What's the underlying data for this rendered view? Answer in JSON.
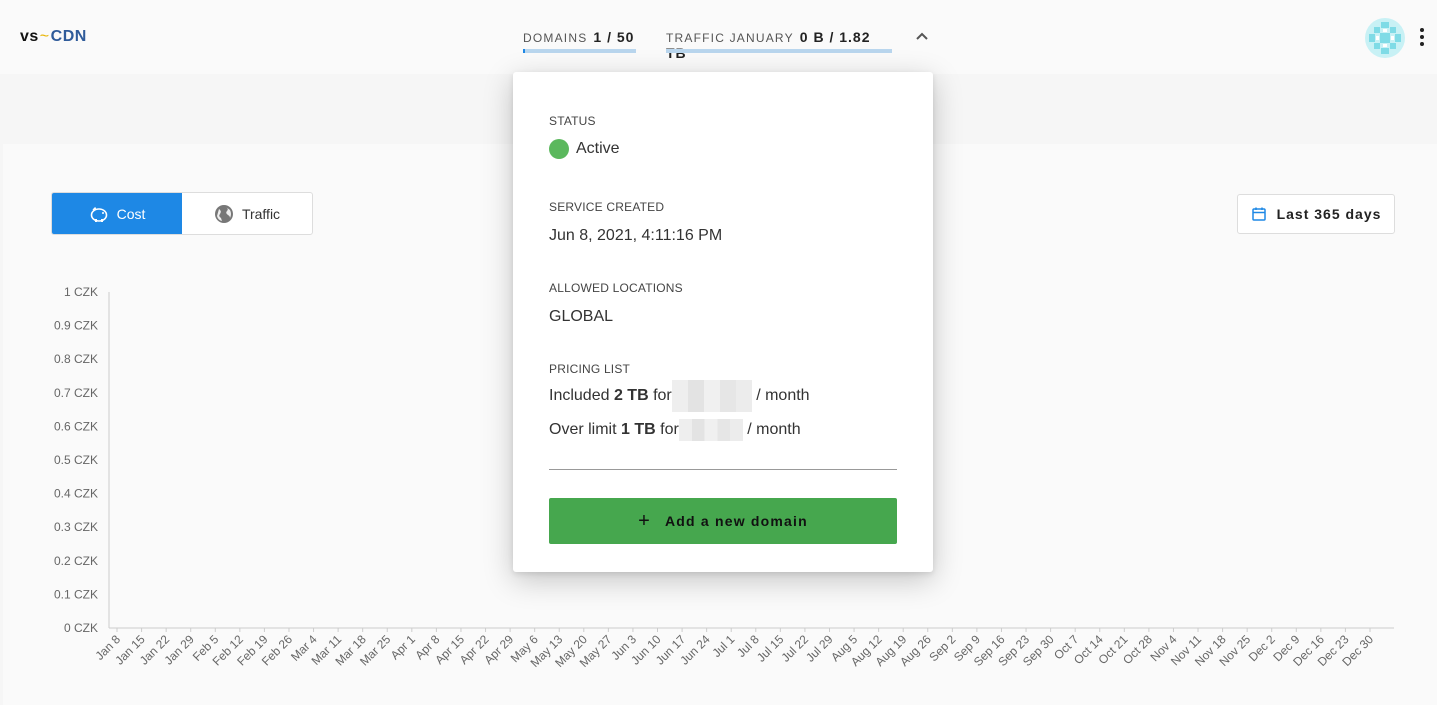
{
  "brand": {
    "vs": "vs",
    "tilde": "~",
    "cdn": "CDN",
    "colors": {
      "vs": "#111111",
      "tilde": "#e8b400",
      "cdn": "#2f5b9a"
    }
  },
  "header": {
    "domains": {
      "label": "DOMAINS",
      "value": "1 / 50",
      "fraction": 0.02
    },
    "traffic": {
      "label": "TRAFFIC JANUARY",
      "value": "0 B / 1.82 TB",
      "fraction": 0.0
    },
    "collapse_icon": "chevron-up-icon",
    "avatar_icon": "avatar-identicon",
    "menu_icon": "kebab-menu-icon"
  },
  "toggle": {
    "cost_label": "Cost",
    "traffic_label": "Traffic",
    "active": "cost",
    "cost_icon": "piggy-bank-icon",
    "traffic_icon": "globe-icon"
  },
  "date_range": {
    "label": "Last 365 days",
    "icon": "calendar-icon"
  },
  "popover": {
    "status_label": "STATUS",
    "status_value": "Active",
    "status_color": "#5bb85d",
    "created_label": "SERVICE CREATED",
    "created_value": "Jun 8, 2021, 4:11:16 PM",
    "locations_label": "ALLOWED LOCATIONS",
    "locations_value": "GLOBAL",
    "pricing_label": "PRICING LIST",
    "included_prefix": "Included",
    "included_amount": "2 TB",
    "included_for": "for",
    "included_suffix": "/ month",
    "over_prefix": "Over limit",
    "over_amount": "1 TB",
    "over_for": "for",
    "over_suffix": "/ month",
    "add_button_label": "Add a new domain",
    "add_button_color": "#46a74e"
  },
  "chart_data": {
    "type": "line",
    "y_ticks": [
      "0 CZK",
      "0.1 CZK",
      "0.2 CZK",
      "0.3 CZK",
      "0.4 CZK",
      "0.5 CZK",
      "0.6 CZK",
      "0.7 CZK",
      "0.8 CZK",
      "0.9 CZK",
      "1 CZK"
    ],
    "ylim": [
      0,
      1
    ],
    "x_ticks": [
      "Jan 8",
      "Jan 15",
      "Jan 22",
      "Jan 29",
      "Feb 5",
      "Feb 12",
      "Feb 19",
      "Feb 26",
      "Mar 4",
      "Mar 11",
      "Mar 18",
      "Mar 25",
      "Apr 1",
      "Apr 8",
      "Apr 15",
      "Apr 22",
      "Apr 29",
      "May 6",
      "May 13",
      "May 20",
      "May 27",
      "Jun 3",
      "Jun 10",
      "Jun 17",
      "Jun 24",
      "Jul 1",
      "Jul 8",
      "Jul 15",
      "Jul 22",
      "Jul 29",
      "Aug 5",
      "Aug 12",
      "Aug 19",
      "Aug 26",
      "Sep 2",
      "Sep 9",
      "Sep 16",
      "Sep 23",
      "Sep 30",
      "Oct 7",
      "Oct 14",
      "Oct 21",
      "Oct 28",
      "Nov 4",
      "Nov 11",
      "Nov 18",
      "Nov 25",
      "Dec 2",
      "Dec 9",
      "Dec 16",
      "Dec 23",
      "Dec 30"
    ],
    "series": [],
    "grid": false
  }
}
